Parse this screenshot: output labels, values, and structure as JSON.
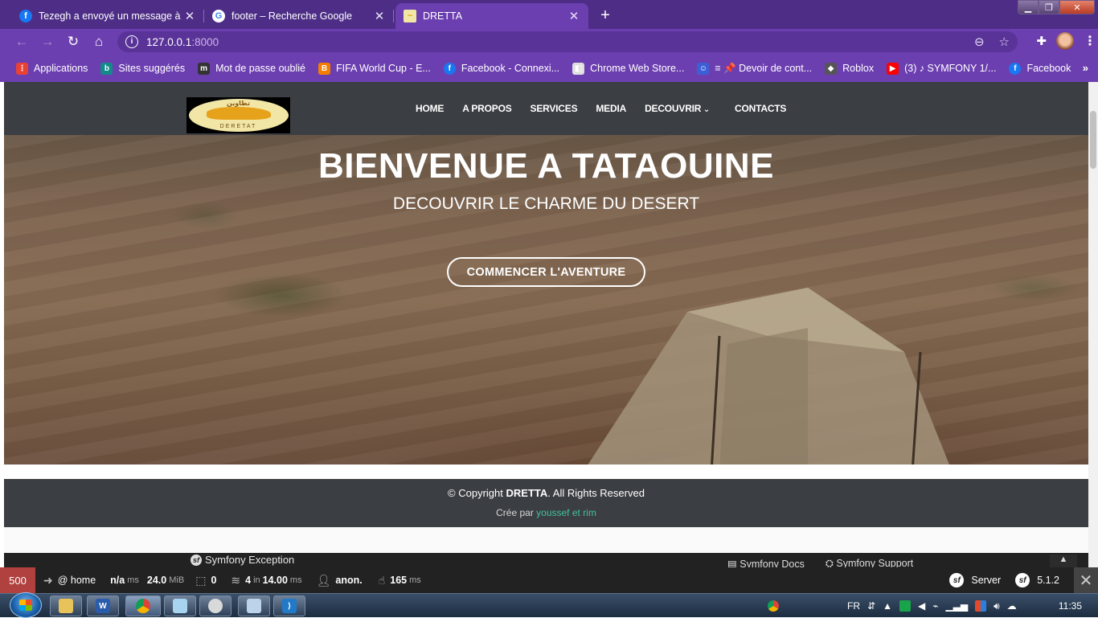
{
  "browser": {
    "tabs": [
      {
        "title": "Tezegh a envoyé un message à à…",
        "icon": "facebook-icon",
        "active": false
      },
      {
        "title": "footer – Recherche Google",
        "icon": "google-icon",
        "active": false
      },
      {
        "title": "DRETTA",
        "icon": "site-favicon-icon",
        "active": true
      }
    ],
    "address": {
      "host": "127.0.0.1",
      "port": ":8000"
    },
    "bookmarks": [
      {
        "label": "Applications",
        "icon": "apps-grid-icon",
        "color": "#e94235"
      },
      {
        "label": "Sites suggérés",
        "icon": "bing-icon",
        "color": "#138a8a"
      },
      {
        "label": "Mot de passe oublié",
        "icon": "m-icon",
        "color": "#333333"
      },
      {
        "label": "FIFA World Cup - E...",
        "icon": "blogger-icon",
        "color": "#f57d00"
      },
      {
        "label": "Facebook - Connexi...",
        "icon": "facebook-icon",
        "color": "#1877f2"
      },
      {
        "label": "Chrome Web Store...",
        "icon": "chrome-store-icon",
        "color": "#e0e0e0"
      },
      {
        "label": "≡ 📌 Devoir de cont...",
        "icon": "classroom-icon",
        "color": "#3c5fd6"
      },
      {
        "label": "Roblox",
        "icon": "roblox-icon",
        "color": "#555555"
      },
      {
        "label": "(3) ♪ SYMFONY 1/...",
        "icon": "youtube-icon",
        "color": "#ff0000"
      },
      {
        "label": "Facebook",
        "icon": "facebook-icon",
        "color": "#1877f2"
      }
    ],
    "bookmarks_more": "»"
  },
  "site": {
    "logo": {
      "arabic": "تطاوين",
      "latin": "DERETAT"
    },
    "menu": [
      "HOME",
      "A PROPOS",
      "SERVICES",
      "MEDIA",
      "DECOUVRIR",
      "CONTACTS"
    ],
    "hero": {
      "title": "BIENVENUE A TATAOUINE",
      "subtitle": "DECOUVRIR LE CHARME DU DESERT",
      "button": "COMMENCER L'AVENTURE"
    },
    "footer": {
      "copyright_prefix": "© Copyright ",
      "brand": "DRETTA",
      "copyright_suffix": ". All Rights Reserved",
      "credit_prefix": "Crée par ",
      "credit_names": "youssef et rim"
    }
  },
  "symfony": {
    "exception_title": "Symfony Exception",
    "links": [
      "Symfony Docs",
      "Symfony Support"
    ],
    "toolbar": {
      "status": "500",
      "route": "@ home",
      "time_value": "n/a",
      "time_unit": "ms",
      "memory_value": "24.0",
      "memory_unit": "MiB",
      "forms": "0",
      "twig_count": "4",
      "twig_in": "in",
      "twig_time": "14.00",
      "twig_unit": "ms",
      "user": "anon.",
      "ajax_value": "165",
      "ajax_unit": "ms",
      "server": "Server",
      "version": "5.1.2"
    }
  },
  "taskbar": {
    "language": "FR",
    "time": "11:35"
  }
}
